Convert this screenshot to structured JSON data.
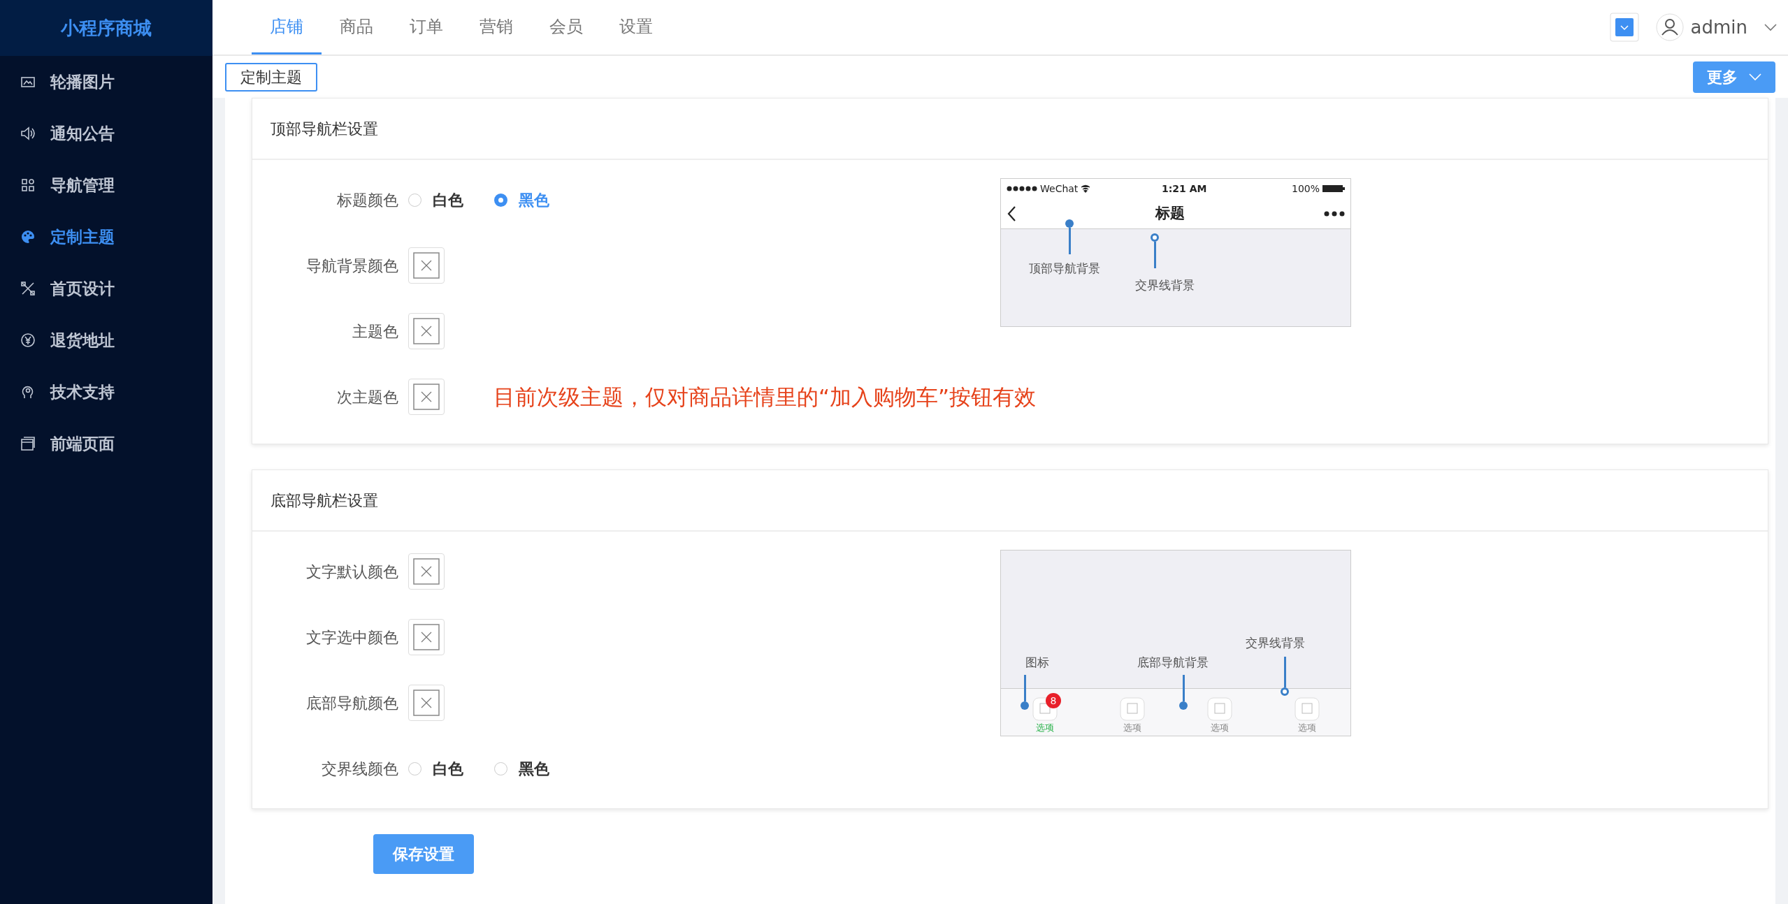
{
  "brand": "小程序商城",
  "sidebar": {
    "items": [
      {
        "label": "轮播图片",
        "selected": false
      },
      {
        "label": "通知公告",
        "selected": false
      },
      {
        "label": "导航管理",
        "selected": false
      },
      {
        "label": "定制主题",
        "selected": true
      },
      {
        "label": "首页设计",
        "selected": false
      },
      {
        "label": "退货地址",
        "selected": false
      },
      {
        "label": "技术支持",
        "selected": false
      },
      {
        "label": "前端页面",
        "selected": false
      }
    ]
  },
  "top_tabs": [
    {
      "label": "店铺",
      "selected": true
    },
    {
      "label": "商品",
      "selected": false
    },
    {
      "label": "订单",
      "selected": false
    },
    {
      "label": "营销",
      "selected": false
    },
    {
      "label": "会员",
      "selected": false
    },
    {
      "label": "设置",
      "selected": false
    }
  ],
  "user": {
    "name": "admin"
  },
  "open_tabs": [
    {
      "label": "定制主题",
      "selected": true
    }
  ],
  "more_button": "更多",
  "sections": [
    {
      "title": "顶部导航栏设置",
      "kind": "top",
      "fields": [
        {
          "kind": "radio",
          "label": "标题颜色",
          "options": [
            {
              "label": "白色",
              "selected": false
            },
            {
              "label": "黑色",
              "selected": true
            }
          ]
        },
        {
          "kind": "color",
          "label": "导航背景颜色"
        },
        {
          "kind": "color",
          "label": "主题色"
        },
        {
          "kind": "color",
          "label": "次主题色",
          "note": "目前次级主题，仅对商品详情里的“加入购物车”按钮有效"
        }
      ],
      "preview": {
        "carrier": "WeChat",
        "time": "1:21 AM",
        "battery": "100%",
        "title": "标题",
        "annotations": [
          "顶部导航背景",
          "交界线背景"
        ]
      }
    },
    {
      "title": "底部导航栏设置",
      "kind": "bottom",
      "fields": [
        {
          "kind": "color",
          "label": "文字默认颜色"
        },
        {
          "kind": "color",
          "label": "文字选中颜色"
        },
        {
          "kind": "color",
          "label": "底部导航颜色"
        },
        {
          "kind": "radio",
          "label": "交界线颜色",
          "options": [
            {
              "label": "白色",
              "selected": false
            },
            {
              "label": "黑色",
              "selected": false
            }
          ]
        }
      ],
      "preview": {
        "annotations": [
          "图标",
          "底部导航背景",
          "交界线背景"
        ],
        "badge": "8",
        "tabs": [
          {
            "label": "选项",
            "selected": true
          },
          {
            "label": "选项",
            "selected": false
          },
          {
            "label": "选项",
            "selected": false
          },
          {
            "label": "选项",
            "selected": false
          }
        ]
      }
    }
  ],
  "save_button": "保存设置"
}
